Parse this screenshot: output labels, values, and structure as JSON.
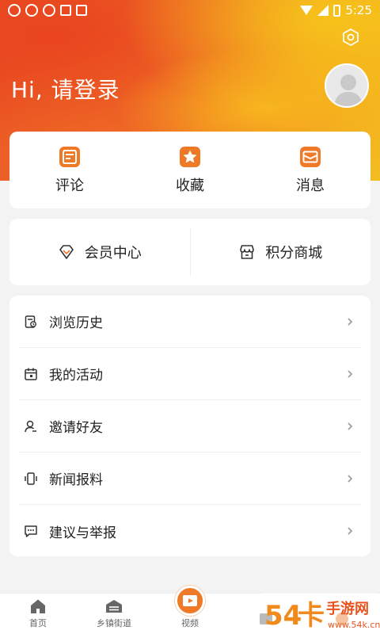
{
  "status_bar": {
    "time": "5:25"
  },
  "header": {
    "greeting": "Hi, 请登录"
  },
  "quick_actions": [
    {
      "label": "评论",
      "icon": "comment-icon"
    },
    {
      "label": "收藏",
      "icon": "star-icon"
    },
    {
      "label": "消息",
      "icon": "message-icon"
    }
  ],
  "member": [
    {
      "label": "会员中心",
      "icon": "diamond-icon"
    },
    {
      "label": "积分商城",
      "icon": "shop-icon"
    }
  ],
  "menu": [
    {
      "label": "浏览历史",
      "icon": "history-icon"
    },
    {
      "label": "我的活动",
      "icon": "calendar-icon"
    },
    {
      "label": "邀请好友",
      "icon": "user-add-icon"
    },
    {
      "label": "新闻报料",
      "icon": "phone-vibrate-icon"
    },
    {
      "label": "建议与举报",
      "icon": "feedback-icon"
    }
  ],
  "tabbar": [
    {
      "label": "首页",
      "icon": "home-icon"
    },
    {
      "label": "乡镇街道",
      "icon": "street-icon"
    },
    {
      "label": "视频",
      "icon": "video-icon"
    },
    {
      "label": "",
      "icon": ""
    },
    {
      "label": "",
      "icon": ""
    }
  ],
  "watermark": {
    "text": "54卡手游网",
    "sub": "www.54k.cn"
  },
  "colors": {
    "accent": "#ee7a28",
    "hero_start": "#e84a22",
    "hero_end": "#f3bd21"
  }
}
